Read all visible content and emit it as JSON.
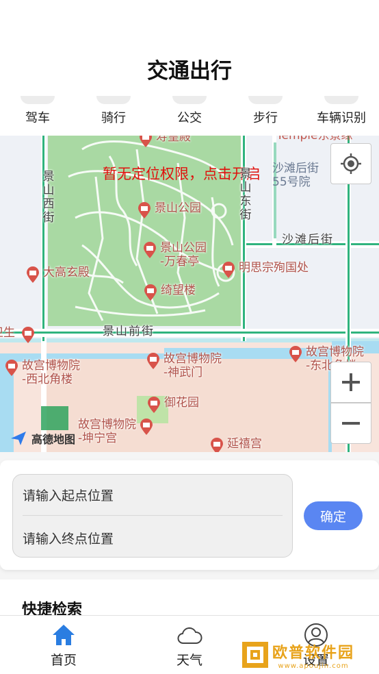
{
  "header": {
    "title": "交通出行"
  },
  "modes": [
    "驾车",
    "骑行",
    "公交",
    "步行",
    "车辆识别"
  ],
  "map": {
    "location_tip": "暂无定位权限，点击开启",
    "logo_text": "高德地图",
    "pois": [
      "寿皇殿",
      "景山公园",
      "景山公园\n-万春亭",
      "大高玄殿",
      "明思宗殉国处",
      "绮望楼",
      "故宫博物院\n-西北角楼",
      "故宫博物院\n-神武门",
      "故宫博物院\n-东北角楼",
      "御花园",
      "故宫博物院\n-坤宁宫",
      "延禧宫",
      "卫生"
    ],
    "streets": {
      "jingshan_west": "景山西街",
      "jingshan_east": "景山东街",
      "shatan_back": "沙滩后街",
      "jingshan_front": "景山前街",
      "shatan_back_55": "沙滩后街\n55号院",
      "temple": "Temple东景缘"
    }
  },
  "route": {
    "start_placeholder": "请输入起点位置",
    "end_placeholder": "请输入终点位置",
    "confirm_label": "确定"
  },
  "quick": {
    "title": "快捷检索"
  },
  "tabbar": {
    "items": [
      {
        "label": "首页",
        "icon": "home-icon",
        "active": true
      },
      {
        "label": "天气",
        "icon": "cloud-icon",
        "active": false
      },
      {
        "label": "设置",
        "icon": "user-icon",
        "active": false
      }
    ]
  },
  "watermark": {
    "text": "欧普软件园",
    "url": "www.apoujin.com"
  },
  "colors": {
    "accent": "#5a86f2",
    "tip_red": "#e0110d",
    "active_tab": "#2a7de1"
  }
}
